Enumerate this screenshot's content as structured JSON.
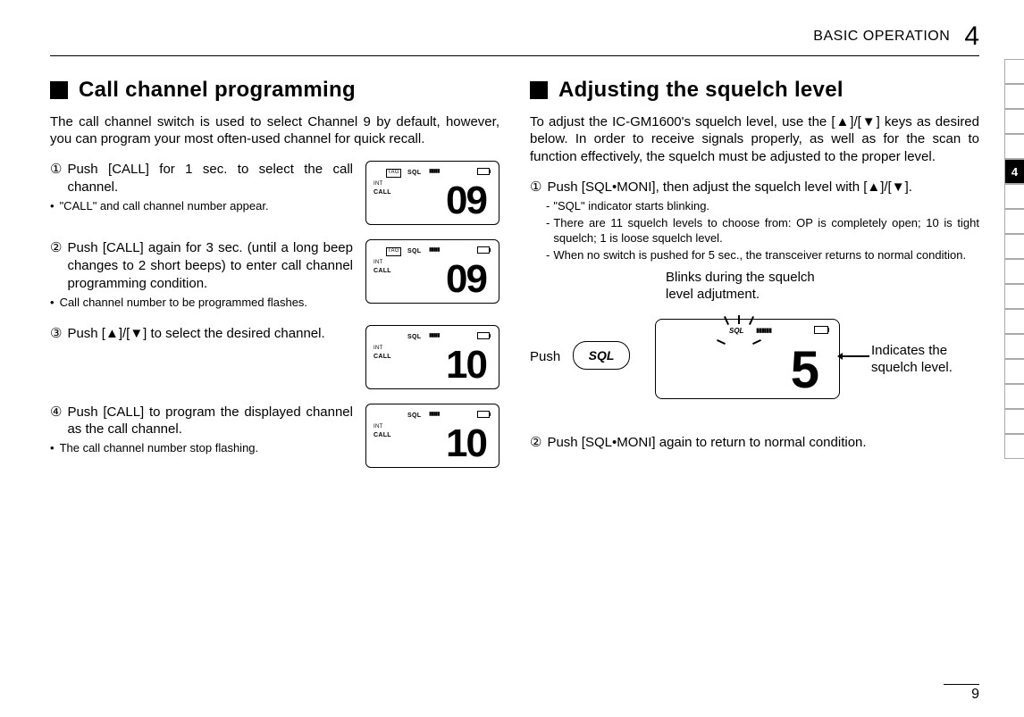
{
  "header": {
    "title": "BASIC OPERATION",
    "chapter": "4"
  },
  "left": {
    "title": "Call channel programming",
    "intro": "The call channel switch is used to select Channel 9 by default, however, you can program your most often-used channel for quick recall.",
    "steps": {
      "s1": {
        "num": "①",
        "text": "Push [CALL] for 1 sec. to select the call channel.",
        "note": "\"CALL\" and call channel number appear.",
        "lcd": {
          "tag": "TAG",
          "sql": "SQL",
          "int": "INT",
          "call": "CALL",
          "digits": "09"
        }
      },
      "s2": {
        "num": "②",
        "text": "Push [CALL] again for 3 sec. (until a long beep changes to 2 short beeps) to enter call channel programming condition.",
        "note": "Call channel number to be programmed flashes.",
        "lcd": {
          "tag": "TAG",
          "sql": "SQL",
          "int": "INT",
          "call": "CALL",
          "digits": "09"
        }
      },
      "s3": {
        "num": "③",
        "text": "Push [▲]/[▼] to select the desired channel.",
        "lcd": {
          "sql": "SQL",
          "int": "INT",
          "call": "CALL",
          "digits": "10"
        }
      },
      "s4": {
        "num": "④",
        "text": "Push [CALL] to program the displayed channel as the call channel.",
        "note": "The call channel number stop flashing.",
        "lcd": {
          "sql": "SQL",
          "int": "INT",
          "call": "CALL",
          "digits": "10"
        }
      }
    }
  },
  "right": {
    "title": "Adjusting the squelch level",
    "intro": "To adjust the IC-GM1600's squelch level, use the [▲]/[▼] keys as desired below. In order to receive signals properly, as well as for the scan to function effectively, the squelch must be adjusted to the proper level.",
    "step1": {
      "num": "①",
      "text": "Push [SQL•MONI], then adjust the squelch level with [▲]/[▼].",
      "sub1": "\"SQL\" indicator starts blinking.",
      "sub2": "There are 11 squelch levels to choose from: OP is completely open; 10 is tight squelch; 1 is loose squelch level.",
      "sub3": "When no switch is pushed for 5 sec., the transceiver returns to normal condition."
    },
    "diagram": {
      "caption_top": "Blinks during the squelch level adjutment.",
      "push": "Push",
      "button": "SQL",
      "lcd": {
        "sql": "SQL",
        "digit": "5"
      },
      "indicates": "Indicates the squelch level."
    },
    "step2": {
      "num": "②",
      "text": "Push [SQL•MONI] again to return to normal condition."
    }
  },
  "tabs": {
    "active": "4"
  },
  "footer": {
    "page": "9"
  }
}
